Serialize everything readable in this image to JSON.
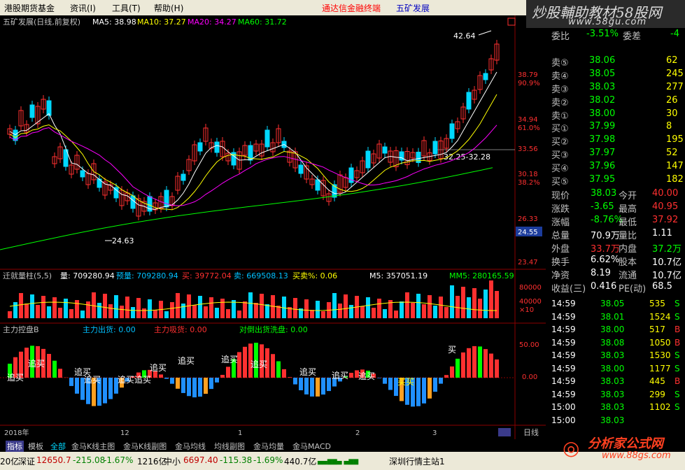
{
  "menu": {
    "items": [
      "港股期货基金",
      "资讯(I)",
      "工具(T)",
      "帮助(H)"
    ],
    "ad": "通达信金融终端",
    "stock": "五矿发展"
  },
  "brand": {
    "title": "炒股輔助教材58股网",
    "url": "www.58gu.com"
  },
  "kline": {
    "header": {
      "name": "五矿发展(日线,前复权)",
      "ma5": "MA5: 38.98",
      "ma10": "MA10: 37.27",
      "ma20": "MA20: 34.27",
      "ma60": "MA60: 31.72"
    },
    "price_labels": [
      "38.79",
      "90.9%",
      "34.94",
      "61.0%",
      "33.56",
      "30.18",
      "38.2%",
      "26.33",
      "24.55",
      "23.47"
    ],
    "annotations": {
      "high": "42.64",
      "low": "24.63",
      "range": "32.25-32.28"
    },
    "colors": {
      "up": "#ff3030",
      "down": "#00d8ff",
      "ma5": "#ffffff",
      "ma10": "#ffff00",
      "ma20": "#ff00ff",
      "ma60": "#00ff00"
    }
  },
  "volume": {
    "header": {
      "name": "迁就量柱(5,5)",
      "vol": "量: 709280.94",
      "pre": "预量: 709280.94",
      "buy": "买: 39772.04",
      "sell": "卖: 669508.13",
      "ratio": "买卖%: 0.06",
      "m5": "M5: 357051.19",
      "mm5": "MM5: 280165.59"
    },
    "axis": [
      "80000",
      "40000",
      "×10"
    ]
  },
  "capital": {
    "header": {
      "name": "主力控盘B",
      "out": "主力出货: 0.00",
      "in": "主力吸货: 0.00",
      "hedge": "对倒出货洗盘: 0.00"
    },
    "axis": [
      "50.00",
      "0.00"
    ],
    "labels": [
      "追买",
      "追买",
      "追买",
      "追买",
      "追买",
      "追买",
      "追买",
      "追买",
      "追买",
      "追买",
      "追买",
      "追买",
      "追买",
      "买买",
      "买"
    ]
  },
  "timeaxis": {
    "labels": [
      "2018年",
      "12",
      "1",
      "2",
      "3"
    ],
    "period": "日线"
  },
  "rightpanel": {
    "weibi": {
      "label": "委比",
      "value": "-3.51%",
      "label2": "委差",
      "value2": "-4"
    },
    "asks": [
      {
        "label": "卖⑤",
        "price": "38.06",
        "vol": "62"
      },
      {
        "label": "卖④",
        "price": "38.05",
        "vol": "245"
      },
      {
        "label": "卖③",
        "price": "38.03",
        "vol": "277"
      },
      {
        "label": "卖②",
        "price": "38.02",
        "vol": "26"
      },
      {
        "label": "卖①",
        "price": "38.00",
        "vol": "30"
      }
    ],
    "bids": [
      {
        "label": "买①",
        "price": "37.99",
        "vol": "8"
      },
      {
        "label": "买②",
        "price": "37.98",
        "vol": "195"
      },
      {
        "label": "买③",
        "price": "37.97",
        "vol": "52"
      },
      {
        "label": "买④",
        "price": "37.96",
        "vol": "147"
      },
      {
        "label": "买⑤",
        "price": "37.95",
        "vol": "182"
      }
    ],
    "stats": [
      {
        "l1": "现价",
        "v1": "38.03",
        "l2": "今开",
        "v2": "40.00"
      },
      {
        "l1": "涨跌",
        "v1": "-3.65",
        "l2": "最高",
        "v2": "40.95"
      },
      {
        "l1": "涨幅",
        "v1": "-8.76%",
        "l2": "最低",
        "v2": "37.92"
      },
      {
        "l1": "总量",
        "v1": "70.9万",
        "l2": "量比",
        "v2": "1.11"
      },
      {
        "l1": "外盘",
        "v1": "33.7万",
        "l2": "内盘",
        "v2": "37.2万"
      },
      {
        "l1": "换手",
        "v1": "6.62%",
        "l2": "股本",
        "v2": "10.7亿"
      },
      {
        "l1": "净资",
        "v1": "8.19",
        "l2": "流通",
        "v2": "10.7亿"
      },
      {
        "l1": "收益(三)",
        "v1": "0.416",
        "l2": "PE(动)",
        "v2": "68.5"
      }
    ],
    "ticks": [
      {
        "time": "14:59",
        "price": "38.05",
        "vol": "535",
        "bs": "S"
      },
      {
        "time": "14:59",
        "price": "38.01",
        "vol": "1524",
        "bs": "S"
      },
      {
        "time": "14:59",
        "price": "38.00",
        "vol": "517",
        "bs": "B"
      },
      {
        "time": "14:59",
        "price": "38.08",
        "vol": "1050",
        "bs": "B"
      },
      {
        "time": "14:59",
        "price": "38.03",
        "vol": "1530",
        "bs": "S"
      },
      {
        "time": "14:59",
        "price": "38.00",
        "vol": "1177",
        "bs": "S"
      },
      {
        "time": "14:59",
        "price": "38.03",
        "vol": "445",
        "bs": "B"
      },
      {
        "time": "14:59",
        "price": "38.03",
        "vol": "299",
        "bs": "S"
      },
      {
        "time": "15:00",
        "price": "38.03",
        "vol": "1102",
        "bs": "S"
      },
      {
        "time": "15:00",
        "price": "38.03",
        "vol": "",
        "bs": ""
      }
    ]
  },
  "tabs": [
    "指标",
    "模板",
    "全部",
    "金马K线主图",
    "金马K线副图",
    "金马均线",
    "均线副图",
    "金马均量",
    "金马MACD"
  ],
  "status": {
    "idx1": "20亿",
    "sz_label": "深证",
    "sz_val": "12650.7",
    "sz_chg": "-215.08",
    "sz_pct": "-1.67%",
    "sz_amt": "1216亿",
    "zx_label": "中小",
    "zx_val": "6697.40",
    "zx_chg": "-115.38",
    "zx_pct": "-1.69%",
    "zx_amt": "440.7亿",
    "server": "深圳行情主站1"
  },
  "watermark": {
    "title": "分析家公式网",
    "url": "www.88gs.com"
  }
}
